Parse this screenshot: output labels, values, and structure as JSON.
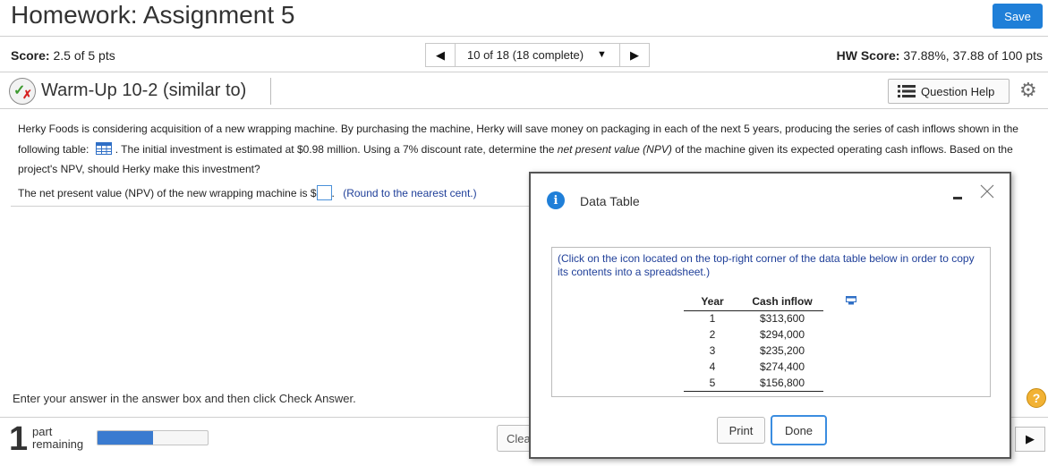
{
  "header": {
    "title": "Homework: Assignment 5",
    "save_label": "Save"
  },
  "score_bar": {
    "score_label": "Score:",
    "score_value": "2.5 of 5 pts",
    "nav_label": "10 of 18 (18 complete)",
    "hw_score_label": "HW Score:",
    "hw_score_value": "37.88%, 37.88 of 100 pts"
  },
  "question": {
    "title": "Warm-Up 10-2 (similar to)",
    "help_label": "Question Help"
  },
  "problem": {
    "text_1": "Herky Foods is considering acquisition of a new wrapping machine. By purchasing the machine, Herky will save money on packaging in each of the next 5 years, producing the series of cash inflows shown in the following table:",
    "text_2": ". The initial investment is estimated at $0.98 million. Using a 7% discount rate, determine the",
    "text_italic": "net present value (NPV)",
    "text_3": "of the machine given its expected operating cash inflows. Based on the project's NPV, should Herky make this investment?"
  },
  "answer": {
    "prefix": "The net present value (NPV) of the new wrapping machine is $",
    "value": "",
    "suffix": ".",
    "round_note": "(Round to the nearest cent.)"
  },
  "footer": {
    "instruction": "Enter your answer in the answer box and then click Check Answer.",
    "help_icon": "?",
    "part_number": "1",
    "part_word": "part",
    "remaining_word": "remaining",
    "progress_fraction": 0.5,
    "clear_label": "Clea"
  },
  "dialog": {
    "info_icon": "i",
    "title": "Data Table",
    "note": "(Click on the icon located on the top-right corner of the data table below in order to copy its contents into a spreadsheet.)",
    "col_year": "Year",
    "col_cash": "Cash inflow",
    "rows": [
      {
        "year": "1",
        "cash": "$313,600"
      },
      {
        "year": "2",
        "cash": "$294,000"
      },
      {
        "year": "3",
        "cash": "$235,200"
      },
      {
        "year": "4",
        "cash": "$274,400"
      },
      {
        "year": "5",
        "cash": "$156,800"
      }
    ],
    "print_label": "Print",
    "done_label": "Done"
  },
  "colors": {
    "accent": "#1f7fd8",
    "progress_fill": "#3a7bd0",
    "note_text": "#1f3f99",
    "help_icon": "#f2b234"
  },
  "icons": {
    "question_status": "partial-credit-icon",
    "table": "table-grid-icon",
    "settings": "gear-icon",
    "copy": "copy-to-spreadsheet-icon"
  }
}
